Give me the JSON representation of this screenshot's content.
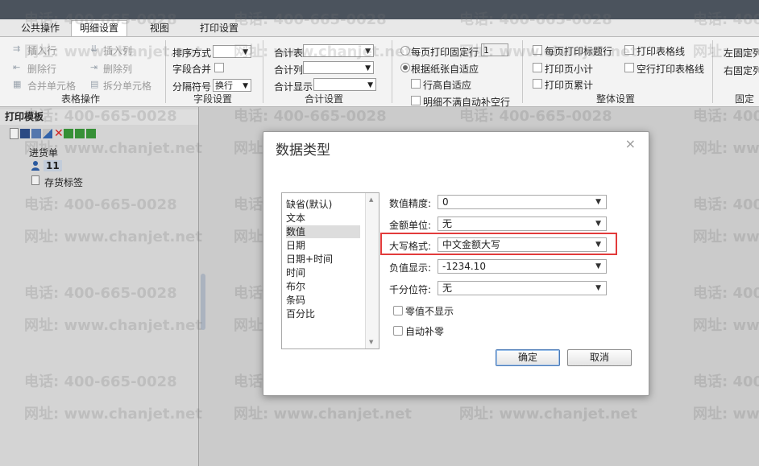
{
  "tabs": [
    "公共操作",
    "明细设置",
    "视图",
    "打印设置"
  ],
  "ribbon": {
    "table_ops": {
      "insert_row": "插入行",
      "insert_col": "插入列",
      "delete_row": "删除行",
      "delete_col": "删除列",
      "merge_cells": "合并单元格",
      "split_cells": "拆分单元格",
      "title": "表格操作"
    },
    "field_settings": {
      "sort_label": "排序方式",
      "merge_label": "字段合并",
      "separator_label": "分隔符号",
      "separator_value": "换行",
      "title": "字段设置"
    },
    "total_settings": {
      "total_table": "合计表",
      "total_col": "合计列",
      "total_display": "合计显示",
      "title": "合计设置"
    },
    "row_settings": {
      "fixed_rows": "每页打印固定行",
      "fixed_rows_value": "1",
      "auto_fit_paper": "根据纸张自适应",
      "row_height_auto": "行高自适应",
      "fill_blank_rows": "明细不满自动补空行"
    },
    "overall_settings": {
      "print_title": "每页打印标题行",
      "print_gridlines": "打印表格线",
      "page_subtotal": "打印页小计",
      "blank_gridlines": "空行打印表格线",
      "page_cumulative": "打印页累计",
      "title": "整体设置"
    },
    "fixed_cols": {
      "left": "左固定列",
      "right": "右固定列",
      "title": "固定列"
    }
  },
  "left_panel": {
    "title": "打印模板",
    "tree": {
      "root": "进货单",
      "item_selected": "11",
      "item2": "存货标签"
    }
  },
  "watermark": {
    "phone": "电话: 400-665-0028",
    "site": "网址: www.chanjet.net"
  },
  "dialog": {
    "title": "数据类型",
    "close": "×",
    "types": [
      "缺省(默认)",
      "文本",
      "数值",
      "日期",
      "日期+时间",
      "时间",
      "布尔",
      "条码",
      "百分比"
    ],
    "selected_type": "数值",
    "fields": {
      "precision_label": "数值精度:",
      "precision_value": "0",
      "unit_label": "金额单位:",
      "unit_value": "无",
      "uppercase_label": "大写格式:",
      "uppercase_value": "中文金额大写",
      "negative_label": "负值显示:",
      "negative_value": "-1234.10",
      "thousands_label": "千分位符:",
      "thousands_value": "无"
    },
    "checkboxes": {
      "zero_hide": "零值不显示",
      "auto_zero": "自动补零"
    },
    "ok": "确定",
    "cancel": "取消"
  },
  "colors": {
    "highlight": "#e23b3b",
    "top_strip": "#4b535d"
  }
}
